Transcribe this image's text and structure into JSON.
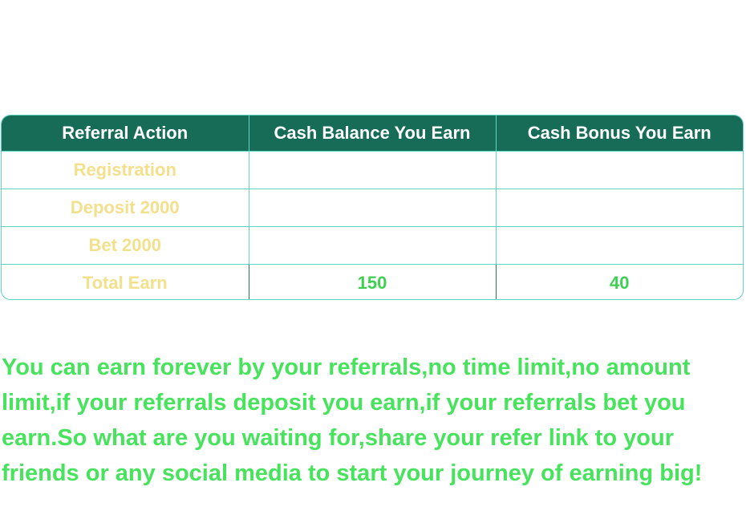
{
  "table": {
    "headers": [
      "Referral Action",
      "Cash Balance You Earn",
      "Cash Bonus You Earn"
    ],
    "rows": [
      {
        "action": "Registration",
        "cash_balance": "",
        "cash_bonus": ""
      },
      {
        "action": "Deposit 2000",
        "cash_balance": "",
        "cash_bonus": ""
      },
      {
        "action": "Bet 2000",
        "cash_balance": "",
        "cash_bonus": ""
      },
      {
        "action": "Total Earn",
        "cash_balance": "150",
        "cash_bonus": "40"
      }
    ]
  },
  "promo_text": "You can earn forever by your referrals,no time limit,no amount limit,if your referrals deposit you earn,if your referrals bet you earn.So what are you waiting for,share your refer link to your friends or any social media to start your journey of earning big!",
  "colors": {
    "header_bg": "#176c57",
    "header_text": "#ffffff",
    "action_text": "#f3e08c",
    "value_text": "#3fcf53",
    "promo_text": "#47e35c",
    "border": "#5fd3c4"
  }
}
